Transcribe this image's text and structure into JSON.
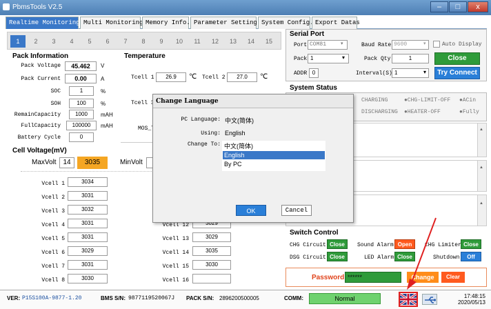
{
  "window": {
    "title": "PbmsTools V2.5",
    "controls": [
      "–",
      "□",
      "x"
    ]
  },
  "tabs": [
    {
      "label": "Realtime Monitoring",
      "active": true
    },
    {
      "label": "Multi Monitoring"
    },
    {
      "label": "Memory Info."
    },
    {
      "label": "Parameter Setting"
    },
    {
      "label": "System Config."
    },
    {
      "label": "Export Datas"
    }
  ],
  "cells": [
    "1",
    "2",
    "3",
    "4",
    "5",
    "6",
    "7",
    "8",
    "9",
    "10",
    "11",
    "12",
    "13",
    "14",
    "15"
  ],
  "pack": {
    "title": "Pack Information",
    "rows": [
      {
        "label": "Pack Voltage",
        "value": "45.462",
        "unit": "V"
      },
      {
        "label": "Pack Current",
        "value": "0.00",
        "unit": "A"
      },
      {
        "label": "SOC",
        "value": "1",
        "unit": "%"
      },
      {
        "label": "SOH",
        "value": "100",
        "unit": "%"
      },
      {
        "label": "RemainCapacity",
        "value": "1000",
        "unit": "mAH"
      },
      {
        "label": "FullCapacity",
        "value": "100000",
        "unit": "mAH"
      },
      {
        "label": "Battery Cycle",
        "value": "0",
        "unit": ""
      }
    ]
  },
  "temperature": {
    "title": "Temperature",
    "tcell1_label": "Tcell 1",
    "tcell1_value": "26.9",
    "tcell1_unit": "℃",
    "tcell2_label": "Tcell 2",
    "tcell2_value": "27.0",
    "tcell2_unit": "℃",
    "tcell3_label": "Tcell 3",
    "mos_label": "MOS_T"
  },
  "cellvoltage": {
    "title": "Cell Voltage(mV)",
    "maxvolt_label": "MaxVolt",
    "maxvolt_cell": "14",
    "maxvolt_value": "3035",
    "minvolt_label": "MinVolt",
    "left": [
      {
        "label": "Vcell 1",
        "value": "3034"
      },
      {
        "label": "Vcell 2",
        "value": "3031"
      },
      {
        "label": "Vcell 3",
        "value": "3032"
      },
      {
        "label": "Vcell 4",
        "value": "3031"
      },
      {
        "label": "Vcell 5",
        "value": "3031"
      },
      {
        "label": "Vcell 6",
        "value": "3029"
      },
      {
        "label": "Vcell 7",
        "value": "3031"
      },
      {
        "label": "Vcell 8",
        "value": "3030"
      }
    ],
    "right": [
      {
        "label": "Vcell 12",
        "value": "3029"
      },
      {
        "label": "Vcell 13",
        "value": "3029"
      },
      {
        "label": "Vcell 14",
        "value": "3035"
      },
      {
        "label": "Vcell 15",
        "value": "3030"
      },
      {
        "label": "Vcell 16",
        "value": ""
      }
    ]
  },
  "serial": {
    "title": "Serial Port",
    "port_label": "Port",
    "port_value": "COM81",
    "baud_label": "Baud Rate",
    "baud_value": "9600",
    "auto_display_label": "Auto Display",
    "pack_label": "Pack",
    "pack_value": "1",
    "packqty_label": "Pack Qty",
    "packqty_value": "1",
    "close_label": "Close",
    "addr_label": "ADDR",
    "addr_value": "0",
    "interval_label": "Interval(S)",
    "interval_value": "1",
    "tryconnect_label": "Try Connect"
  },
  "status": {
    "title": "System Status",
    "row1": [
      "CHARGING",
      "●CHG-LIMIT-OFF",
      "●ACin"
    ],
    "row2": [
      "DISCHARGING",
      "●HEATER-OFF",
      "●Fully"
    ]
  },
  "switch": {
    "title": "Switch Control",
    "chg_circuit": "CHG Circuit",
    "chg_circuit_btn": "Close",
    "sound_alarm": "Sound Alarm",
    "sound_alarm_btn": "Open",
    "chg_limiter": "CHG Limiter",
    "chg_limiter_btn": "Close",
    "dsg_circuit": "DSG Circuit",
    "dsg_circuit_btn": "Close",
    "led_alarm": "LED Alarm",
    "led_alarm_btn": "Close",
    "shutdown": "Shutdown",
    "shutdown_btn": "Off"
  },
  "password": {
    "label": "Password",
    "value": "******",
    "change_label": "Change",
    "clear_label": "Clear"
  },
  "dialog": {
    "title": "Change Language",
    "pc_language_label": "PC Language:",
    "pc_language_value": "中文(简体)",
    "using_label": "Using:",
    "using_value": "English",
    "change_to_label": "Change To:",
    "options": [
      "中文(简体)",
      "English",
      "By PC"
    ],
    "selected": 1,
    "ok_label": "OK",
    "cancel_label": "Cancel"
  },
  "statusbar": {
    "ver_label": "VER:",
    "ver_value": "P15S100A-9877-1.20",
    "bms_label": "BMS S/N:",
    "bms_value": "9877119520067J",
    "pack_label": "PACK S/N:",
    "pack_value": "2896200500005",
    "comm_label": "COMM:",
    "comm_value": "Normal",
    "time": "17:48:15",
    "date": "2020/05/13"
  },
  "colors": {
    "accent": "#3a78c8",
    "green": "#2f9b3a",
    "orange": "#ff5a1f",
    "highlight": "#f5a623",
    "arrow": "#e02020"
  },
  "icons": {
    "flag": "uk-flag-icon",
    "usb": "usb-icon"
  }
}
